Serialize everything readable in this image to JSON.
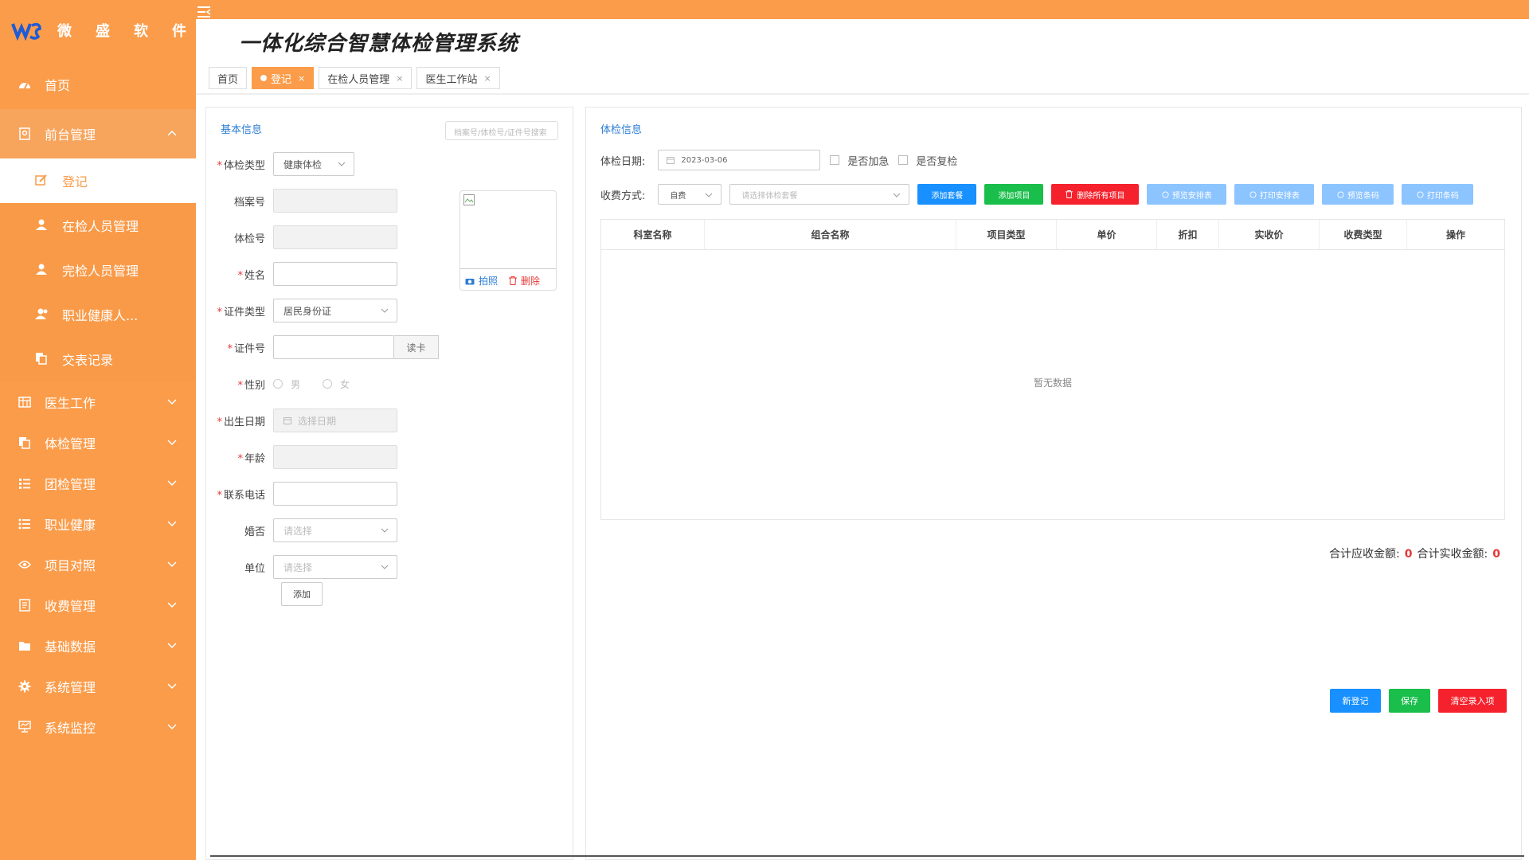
{
  "brand": {
    "chars": [
      "微",
      "盛",
      "软",
      "件"
    ],
    "primary_color": "#fb9c4a"
  },
  "header": {
    "title": "一体化综合智慧体检管理系统"
  },
  "tabs": [
    {
      "label": "首页",
      "active": false,
      "closable": false
    },
    {
      "label": "登记",
      "active": true,
      "closable": true
    },
    {
      "label": "在检人员管理",
      "active": false,
      "closable": true
    },
    {
      "label": "医生工作站",
      "active": false,
      "closable": true
    }
  ],
  "tab_close": "×",
  "sidebar": {
    "home": "首页",
    "front": "前台管理",
    "front_children": {
      "register": "登记",
      "in_exam": "在检人员管理",
      "done_exam": "完检人员管理",
      "occupational": "职业健康人...",
      "submit_record": "交表记录"
    },
    "items": [
      {
        "label": "医生工作",
        "icon": "grid-icon"
      },
      {
        "label": "体检管理",
        "icon": "copy-icon"
      },
      {
        "label": "团检管理",
        "icon": "list-icon"
      },
      {
        "label": "职业健康",
        "icon": "bullet-list-icon"
      },
      {
        "label": "项目对照",
        "icon": "eye-icon"
      },
      {
        "label": "收费管理",
        "icon": "receipt-icon"
      },
      {
        "label": "基础数据",
        "icon": "folder-icon"
      },
      {
        "label": "系统管理",
        "icon": "gear-icon"
      },
      {
        "label": "系统监控",
        "icon": "monitor-icon"
      }
    ]
  },
  "basic_info": {
    "title": "基本信息",
    "search_placeholder": "档案号/体检号/证件号搜索",
    "exam_type_label": "体检类型",
    "exam_type_value": "健康体检",
    "archive_no_label": "档案号",
    "exam_no_label": "体检号",
    "name_label": "姓名",
    "id_type_label": "证件类型",
    "id_type_value": "居民身份证",
    "id_no_label": "证件号",
    "read_card": "读卡",
    "gender_label": "性别",
    "gender_male": "男",
    "gender_female": "女",
    "birth_label": "出生日期",
    "birth_placeholder": "选择日期",
    "age_label": "年龄",
    "phone_label": "联系电话",
    "marital_label": "婚否",
    "marital_placeholder": "请选择",
    "unit_label": "单位",
    "unit_placeholder": "请选择",
    "add": "添加",
    "photo_take": "拍照",
    "photo_delete": "删除"
  },
  "exam_info": {
    "title": "体检信息",
    "date_label": "体检日期:",
    "date_value": "2023-03-06",
    "urgent_label": "是否加急",
    "recheck_label": "是否复检",
    "pay_label": "收费方式:",
    "pay_value": "自费",
    "package_placeholder": "请选择体检套餐",
    "buttons": {
      "add_package": "添加套餐",
      "add_item": "添加项目",
      "delete_all": "删除所有项目",
      "preview_schedule": "预览安排表",
      "print_schedule": "打印安排表",
      "preview_barcode": "预览条码",
      "print_barcode": "打印条码"
    },
    "columns": [
      "科室名称",
      "组合名称",
      "项目类型",
      "单价",
      "折扣",
      "实收价",
      "收费类型",
      "操作"
    ],
    "empty_text": "暂无数据",
    "total_due_label": "合计应收金额:",
    "total_due": "0",
    "total_paid_label": "合计实收金额:",
    "total_paid": "0",
    "new_register": "新登记",
    "save": "保存",
    "clear": "清空录入项"
  }
}
